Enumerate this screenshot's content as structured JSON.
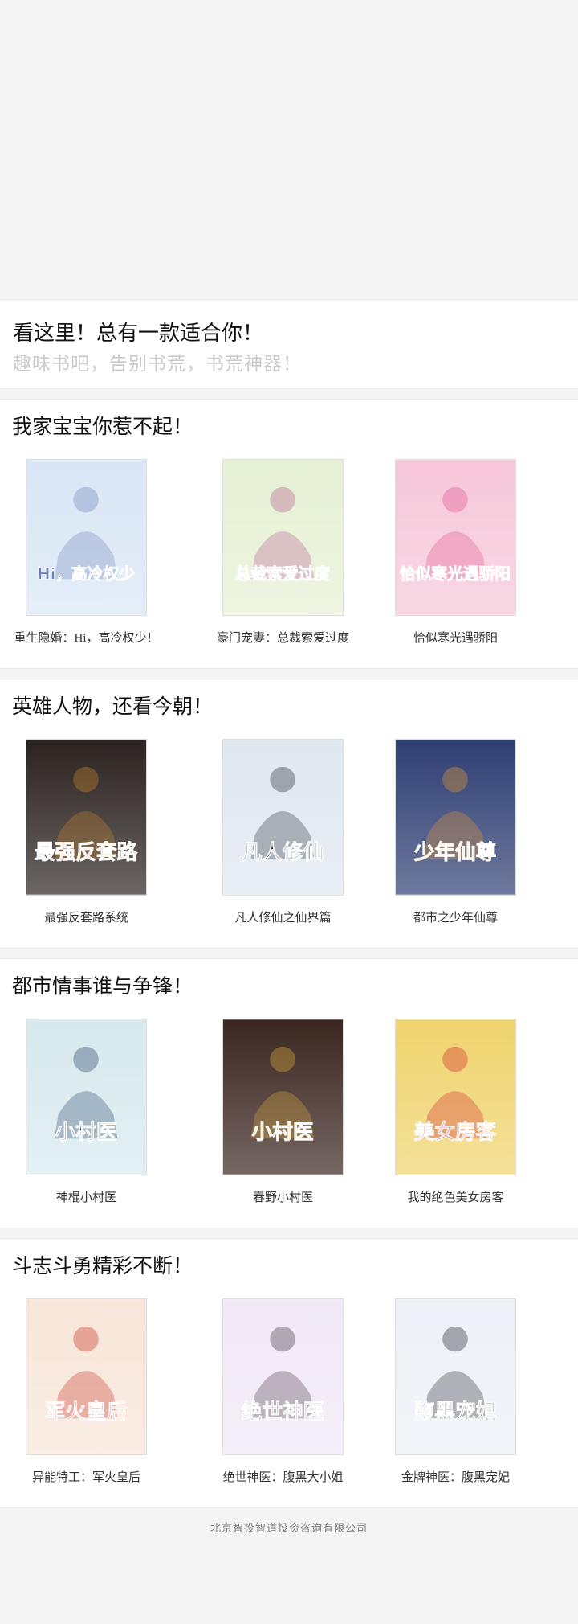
{
  "hero": {
    "title": "看这里！总有一款适合你！",
    "subtitle": "趣味书吧，告别书荒，书荒神器！"
  },
  "sections": [
    {
      "title": "我家宝宝你惹不起！",
      "books": [
        {
          "title": "重生隐婚：Hi，高冷权少！",
          "cover_text": "Hi，高冷权少",
          "colors": [
            "#d9e6f5",
            "#6a7fb8"
          ]
        },
        {
          "title": "豪门宠妻：总裁索爱过度",
          "cover_text": "总裁索爱过度",
          "colors": [
            "#e6f0d4",
            "#b3548b"
          ]
        },
        {
          "title": "恰似寒光遇骄阳",
          "cover_text": "恰似寒光遇骄阳",
          "colors": [
            "#f6c7d8",
            "#e04d8b"
          ]
        }
      ]
    },
    {
      "title": "英雄人物，还看今朝！",
      "books": [
        {
          "title": "最强反套路系统",
          "cover_text": "最强反套路",
          "colors": [
            "#2b2320",
            "#d58a2e"
          ]
        },
        {
          "title": "凡人修仙之仙界篇",
          "cover_text": "凡人修仙",
          "colors": [
            "#dfe7ef",
            "#1e2530"
          ]
        },
        {
          "title": "都市之少年仙尊",
          "cover_text": "少年仙尊",
          "colors": [
            "#2f3f73",
            "#f29d2a"
          ]
        }
      ]
    },
    {
      "title": "都市情事谁与争锋！",
      "books": [
        {
          "title": "神棍小村医",
          "cover_text": "小村医",
          "colors": [
            "#d7e9ee",
            "#1f3a62"
          ]
        },
        {
          "title": "春野小村医",
          "cover_text": "小村医",
          "colors": [
            "#3b2620",
            "#e8b43e"
          ]
        },
        {
          "title": "我的绝色美女房客",
          "cover_text": "美女房客",
          "colors": [
            "#f0d36e",
            "#cc1f27"
          ]
        }
      ]
    },
    {
      "title": "斗志斗勇精彩不断！",
      "books": [
        {
          "title": "异能特工：军火皇后",
          "cover_text": "军火皇后",
          "colors": [
            "#f7e5d8",
            "#c42416"
          ]
        },
        {
          "title": "绝世神医：腹黑大小姐",
          "cover_text": "绝世神医",
          "colors": [
            "#f0e8f5",
            "#3a2a3a"
          ]
        },
        {
          "title": "金牌神医：腹黑宠妃",
          "cover_text": "腹黑宠妃",
          "colors": [
            "#eef0f7",
            "#1a1a22"
          ]
        }
      ]
    }
  ],
  "footer": {
    "text": "北京智投智道投资咨询有限公司"
  }
}
